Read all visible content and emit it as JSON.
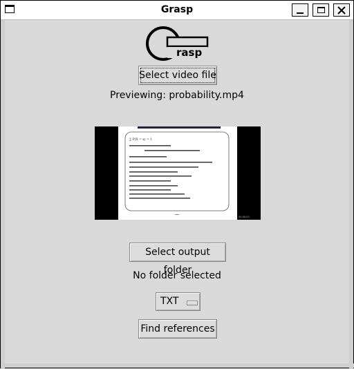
{
  "window": {
    "title": "Grasp",
    "icons": [
      "window-menu-icon",
      "minimize-icon",
      "maximize-icon",
      "close-icon"
    ]
  },
  "logo": {
    "text": "rasp"
  },
  "select_video_button": {
    "label": "Select video file"
  },
  "preview_label": "Previewing: probability.mp4",
  "preview": {
    "slide_title_line": "∑ P(X = x) = 1",
    "timestamp": "00:00:00"
  },
  "select_output_button": {
    "label": "Select output folder"
  },
  "folder_status": "No folder selected",
  "format_menu": {
    "selected": "TXT"
  },
  "find_references_button": {
    "label": "Find references"
  },
  "colors": {
    "background": "#d9d9d9",
    "titlebar": "#ffffff",
    "button": "#dcdcdc"
  }
}
